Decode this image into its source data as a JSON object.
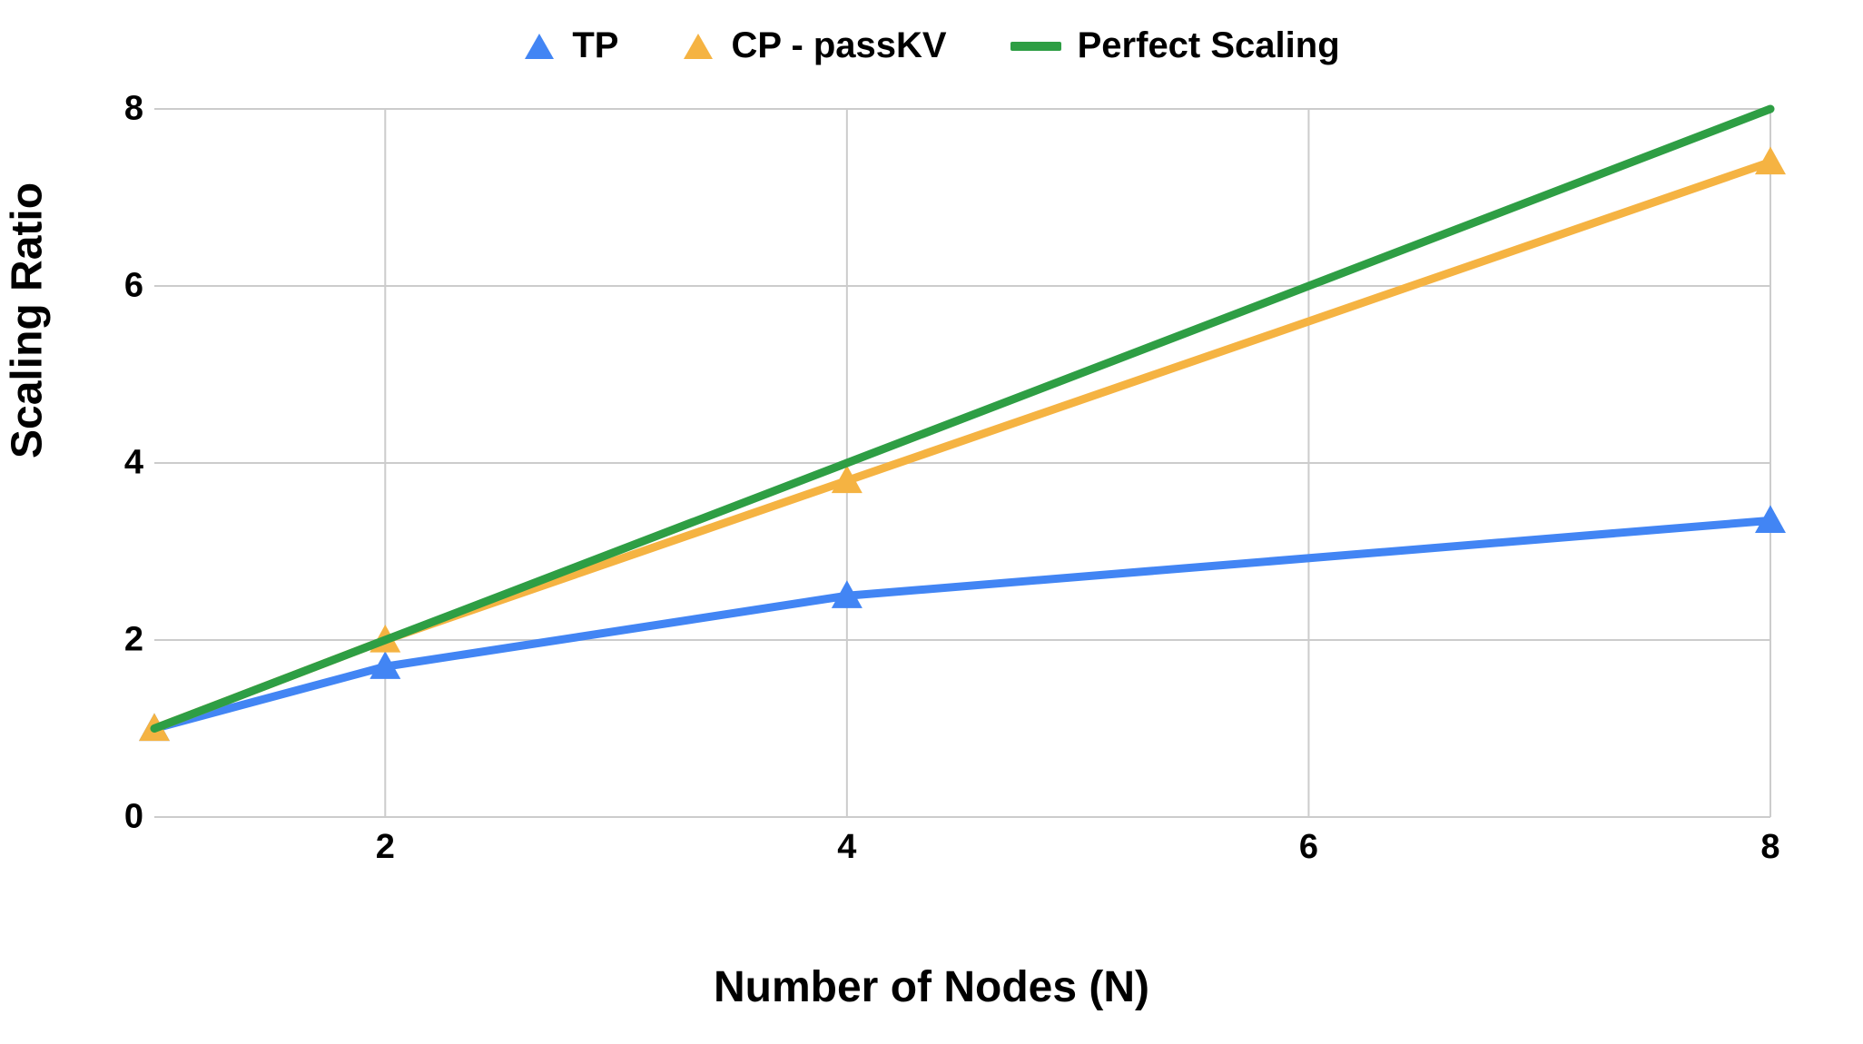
{
  "chart_data": {
    "type": "line",
    "xlabel": "Number of Nodes (N)",
    "ylabel": "Scaling Ratio",
    "x": [
      1,
      2,
      4,
      8
    ],
    "xticks": [
      2,
      4,
      6,
      8
    ],
    "yticks": [
      0,
      2,
      4,
      6,
      8
    ],
    "xrange": [
      1,
      8
    ],
    "yrange": [
      0,
      8
    ],
    "series": [
      {
        "name": "TP",
        "color": "#4285F4",
        "marker": "triangle",
        "values": [
          1.0,
          1.7,
          2.5,
          3.35
        ]
      },
      {
        "name": "CP - passKV",
        "color": "#F5B342",
        "marker": "triangle",
        "values": [
          1.0,
          2.0,
          3.8,
          7.4
        ]
      },
      {
        "name": "Perfect Scaling",
        "color": "#2E9E44",
        "marker": "none",
        "values": [
          1.0,
          2.0,
          4.0,
          8.0
        ]
      }
    ],
    "legend": [
      "TP",
      "CP - passKV",
      "Perfect Scaling"
    ]
  }
}
